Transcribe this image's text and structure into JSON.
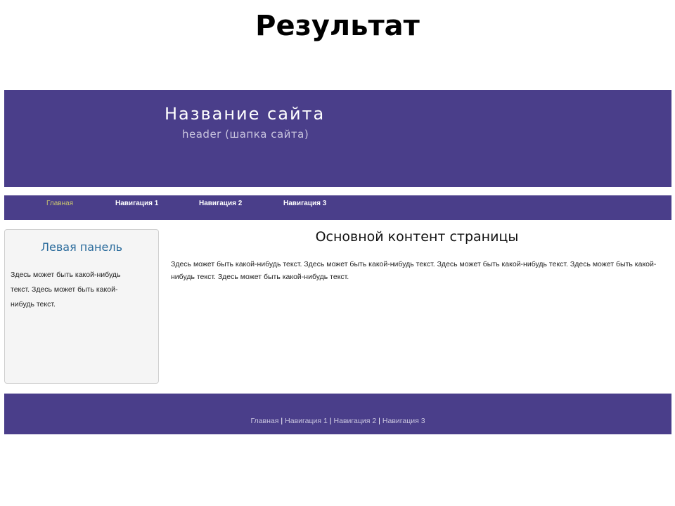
{
  "slide": {
    "title": "Результат"
  },
  "header": {
    "site_name": "Название сайта",
    "subtitle": "header (шапка сайта)"
  },
  "nav": {
    "items": [
      {
        "label": "Главная"
      },
      {
        "label": "Навигация 1"
      },
      {
        "label": "Навигация 2"
      },
      {
        "label": "Навигация 3"
      }
    ]
  },
  "left_panel": {
    "title": "Левая панель",
    "text": "Здесь может быть какой-нибудь текст. Здесь может быть какой-нибудь текст."
  },
  "main": {
    "title": "Основной контент страницы",
    "text": "Здесь может быть какой-нибудь текст. Здесь может быть какой-нибудь текст. Здесь может быть какой-нибудь текст. Здесь может быть какой-нибудь текст. Здесь может быть какой-нибудь текст."
  },
  "footer": {
    "links": [
      {
        "label": "Главная"
      },
      {
        "label": "Навигация 1"
      },
      {
        "label": "Навигация 2"
      },
      {
        "label": "Навигация 3"
      }
    ],
    "separator": "|"
  },
  "colors": {
    "brand": "#4a3e8a",
    "active_nav": "#c8c470",
    "panel_title": "#2a6b9c"
  }
}
